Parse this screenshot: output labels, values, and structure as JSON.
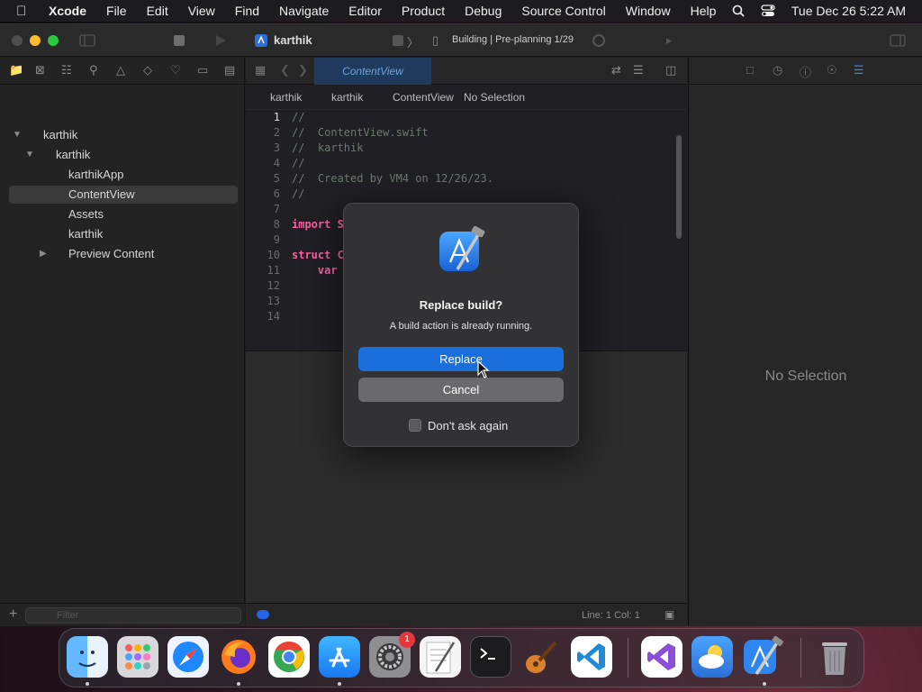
{
  "menubar": {
    "app_name": "Xcode",
    "items": [
      "File",
      "Edit",
      "View",
      "Find",
      "Navigate",
      "Editor",
      "Product",
      "Debug",
      "Source Control",
      "Window",
      "Help"
    ],
    "clock": "Tue Dec 26  5:22 AM"
  },
  "toolbar": {
    "project": "karthik",
    "scheme_separator": "〉",
    "status": "Building | Pre-planning 1/29"
  },
  "navigator": {
    "tree": [
      {
        "label": "karthik",
        "level": 0,
        "expanded": true
      },
      {
        "label": "karthik",
        "level": 1,
        "expanded": true
      },
      {
        "label": "karthikApp",
        "level": 2
      },
      {
        "label": "ContentView",
        "level": 2,
        "selected": true
      },
      {
        "label": "Assets",
        "level": 2
      },
      {
        "label": "karthik",
        "level": 2
      },
      {
        "label": "Preview Content",
        "level": 2,
        "expanded": false
      }
    ],
    "filter_placeholder": "Filter"
  },
  "editor": {
    "active_tab": "ContentView",
    "jumpbar": [
      "karthik",
      "karthik",
      "ContentView",
      "No Selection"
    ],
    "code": [
      {
        "n": "1",
        "text": "//",
        "cls": "comment"
      },
      {
        "n": "2",
        "text": "//  ContentView.swift",
        "cls": "comment"
      },
      {
        "n": "3",
        "text": "//  karthik",
        "cls": "comment"
      },
      {
        "n": "4",
        "text": "//",
        "cls": "comment"
      },
      {
        "n": "5",
        "text": "//  Created by VM4 on 12/26/23.",
        "cls": "comment"
      },
      {
        "n": "6",
        "text": "//",
        "cls": "comment"
      },
      {
        "n": "7",
        "text": "",
        "cls": "plain"
      },
      {
        "n": "8",
        "text": "import S",
        "cls": "kw"
      },
      {
        "n": "9",
        "text": "",
        "cls": "plain"
      },
      {
        "n": "10",
        "text": "struct C",
        "cls": "kw"
      },
      {
        "n": "11",
        "text": "    var",
        "cls": "kw"
      },
      {
        "n": "12",
        "text": "",
        "cls": "plain"
      },
      {
        "n": "13",
        "text": "",
        "cls": "plain"
      },
      {
        "n": "14",
        "text": "",
        "cls": "plain"
      }
    ],
    "status_line": "Line: 1  Col: 1"
  },
  "inspector": {
    "empty_label": "No Selection"
  },
  "dialog": {
    "title": "Replace build?",
    "message": "A build action is already running.",
    "primary_button": "Replace",
    "secondary_button": "Cancel",
    "checkbox_label": "Don't ask again",
    "checkbox_checked": false
  },
  "dock": {
    "apps": [
      "Finder",
      "Launchpad",
      "Safari",
      "Firefox",
      "Chrome",
      "App Store",
      "System Settings",
      "TextEdit",
      "Terminal",
      "Instruments",
      "Visual Studio Code",
      "Visual Studio",
      "Weather",
      "Xcode",
      "Trash"
    ],
    "settings_badge": "1",
    "accent": "#1a6fdc"
  }
}
